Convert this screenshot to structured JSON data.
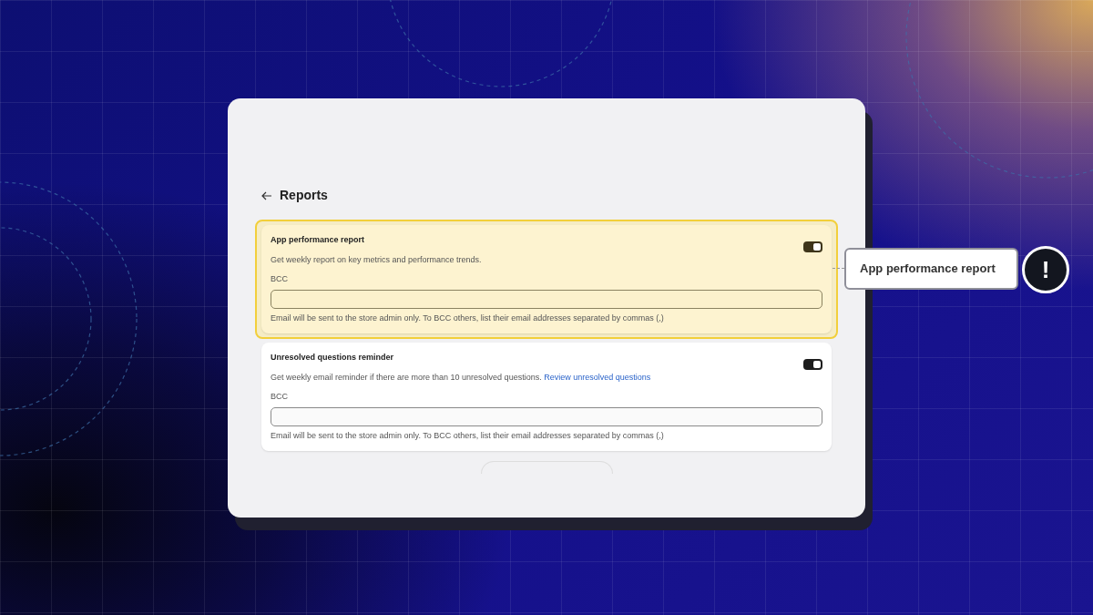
{
  "page": {
    "title": "Reports"
  },
  "cards": [
    {
      "title": "App performance report",
      "description": "Get weekly report on key metrics and performance trends.",
      "on": true,
      "highlighted": true,
      "field_label": "BCC",
      "help": "Email will be sent to the store admin only. To BCC others, list their email addresses separated by commas (,)"
    },
    {
      "title": "Unresolved questions reminder",
      "description": "Get weekly email reminder if there are more than 10 unresolved questions.",
      "link": "Review unresolved questions",
      "on": true,
      "highlighted": false,
      "field_label": "BCC",
      "help": "Email will be sent to the store admin only. To BCC others, list their email addresses separated by commas (,)"
    }
  ],
  "callout": {
    "label": "App performance report",
    "icon_text": "!"
  }
}
